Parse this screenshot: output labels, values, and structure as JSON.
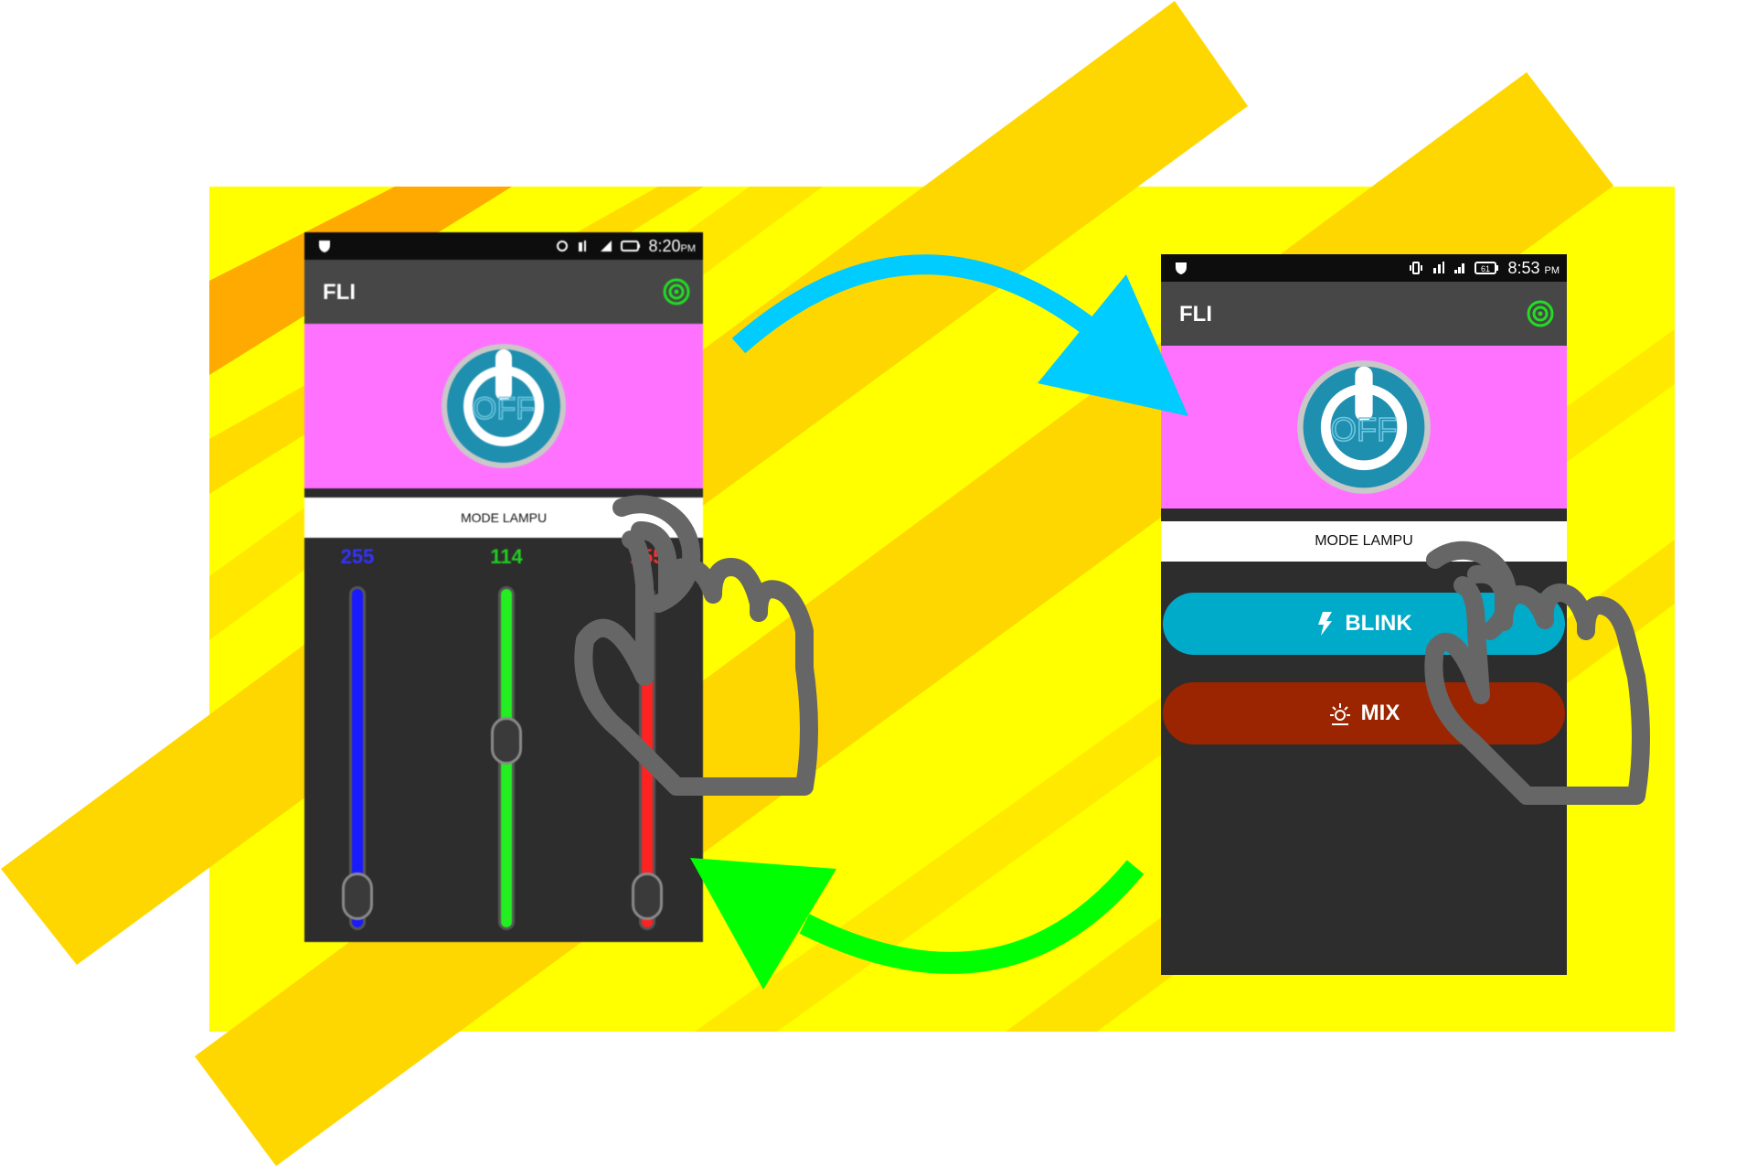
{
  "colors": {
    "bg_yellow": "#ffff00",
    "stripe_gold": "#ffd700",
    "stripe_orange": "#ffaa00",
    "arrow_blue": "#00ccff",
    "arrow_green": "#00ff00",
    "magenta_panel": "#ff72ff",
    "blink_button": "#00abc9",
    "mix_button": "#9b2500",
    "slider_blue": "#1a1aff",
    "slider_green": "#22ee22",
    "slider_red": "#ff2222",
    "connected_green": "#22dd22"
  },
  "left_phone": {
    "status": {
      "time": "8:20",
      "ampm": "PM"
    },
    "app_title": "FLI",
    "power_button_label": "OFF",
    "mode_label": "MODE LAMPU",
    "sliders": [
      {
        "label": "255",
        "color": "#3333ff",
        "level": 0.0
      },
      {
        "label": "114",
        "color": "#22cc22",
        "level": 0.55
      },
      {
        "label": "255",
        "color": "#ff3333",
        "level": 0.0
      }
    ]
  },
  "right_phone": {
    "status": {
      "time": "8:53",
      "ampm": "PM",
      "battery": "61"
    },
    "app_title": "FLI",
    "power_button_label": "OFF",
    "mode_label": "MODE LAMPU",
    "buttons": [
      {
        "label": "BLINK",
        "icon": "lightning-icon"
      },
      {
        "label": "MIX",
        "icon": "mix-burst-icon"
      }
    ]
  },
  "icons": {
    "status_left": "shield-icon",
    "vibrate": "vibrate-icon",
    "signal_3g": "signal-3g-icon",
    "signal": "signal-icon",
    "battery": "battery-icon",
    "bluetooth_connected": "bluetooth-connected-icon",
    "power": "power-icon",
    "hand_tap": "hand-pointer-icon",
    "arrow_forward": "arrow-right-icon",
    "arrow_back": "arrow-left-icon"
  }
}
